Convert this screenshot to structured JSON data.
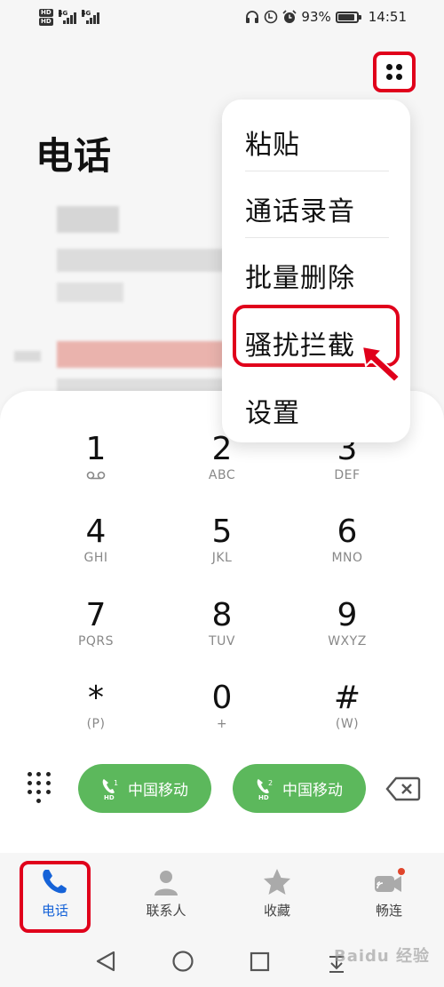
{
  "status_bar": {
    "sim1_badge": "HD",
    "sim2_badge": "HD",
    "sim1_network": "4G",
    "sim2_network": "4G",
    "battery_percent": "93%",
    "battery_level": 0.93,
    "time": "14:51",
    "icons": [
      "headphones-icon",
      "call-recording-icon",
      "alarm-icon",
      "battery-icon"
    ]
  },
  "header": {
    "title": "电话"
  },
  "menu": {
    "items": [
      {
        "label": "粘贴"
      },
      {
        "label": "通话录音"
      },
      {
        "label": "批量删除"
      },
      {
        "label": "骚扰拦截"
      },
      {
        "label": "设置"
      }
    ]
  },
  "keypad": {
    "keys": [
      {
        "digit": "1",
        "sub": ""
      },
      {
        "digit": "2",
        "sub": "ABC"
      },
      {
        "digit": "3",
        "sub": "DEF"
      },
      {
        "digit": "4",
        "sub": "GHI"
      },
      {
        "digit": "5",
        "sub": "JKL"
      },
      {
        "digit": "6",
        "sub": "MNO"
      },
      {
        "digit": "7",
        "sub": "PQRS"
      },
      {
        "digit": "8",
        "sub": "TUV"
      },
      {
        "digit": "9",
        "sub": "WXYZ"
      },
      {
        "digit": "*",
        "sub": "(P)"
      },
      {
        "digit": "0",
        "sub": "+"
      },
      {
        "digit": "#",
        "sub": "(W)"
      }
    ],
    "call_sim1": {
      "label": "中国移动",
      "sim": "1",
      "badge": "HD"
    },
    "call_sim2": {
      "label": "中国移动",
      "sim": "2",
      "badge": "HD"
    }
  },
  "bottom_nav": {
    "items": [
      {
        "label": "电话",
        "icon": "phone-icon",
        "active": true
      },
      {
        "label": "联系人",
        "icon": "contacts-icon",
        "active": false
      },
      {
        "label": "收藏",
        "icon": "star-icon",
        "active": false
      },
      {
        "label": "畅连",
        "icon": "video-call-icon",
        "active": false
      }
    ]
  },
  "watermark": "Baidu 经验",
  "colors": {
    "accent_blue": "#1663d8",
    "call_green": "#5cb85c",
    "highlight_red": "#e0001b"
  }
}
